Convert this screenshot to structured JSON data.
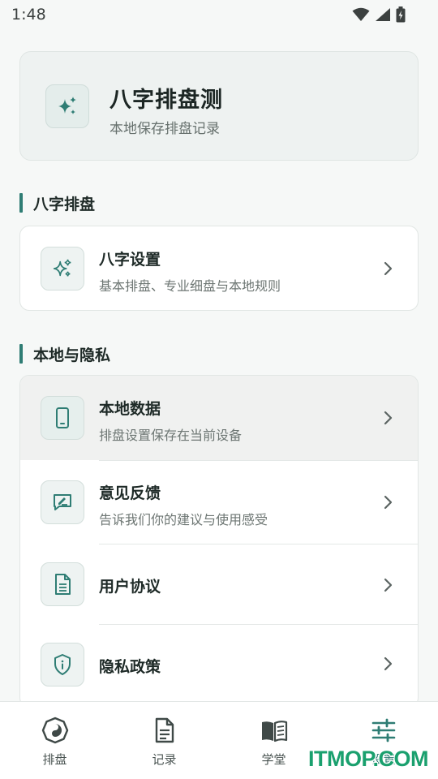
{
  "status_bar": {
    "time": "1:48"
  },
  "hero": {
    "title": "八字排盘测",
    "subtitle": "本地保存排盘记录",
    "icon": "sparkles-icon"
  },
  "sections": [
    {
      "title": "八字排盘",
      "items": [
        {
          "title": "八字设置",
          "subtitle": "基本排盘、专业细盘与本地规则",
          "icon": "sparkles-icon"
        }
      ]
    },
    {
      "title": "本地与隐私",
      "items": [
        {
          "title": "本地数据",
          "subtitle": "排盘设置保存在当前设备",
          "icon": "phone-icon"
        },
        {
          "title": "意见反馈",
          "subtitle": "告诉我们你的建议与使用感受",
          "icon": "feedback-icon"
        },
        {
          "title": "用户协议",
          "subtitle": "",
          "icon": "document-icon"
        },
        {
          "title": "隐私政策",
          "subtitle": "",
          "icon": "shield-info-icon"
        }
      ]
    }
  ],
  "bottom_nav": [
    {
      "label": "排盘",
      "icon": "bagua-icon",
      "active": false
    },
    {
      "label": "记录",
      "icon": "document-icon",
      "active": false
    },
    {
      "label": "学堂",
      "icon": "book-icon",
      "active": false
    },
    {
      "label": "设置",
      "icon": "sliders-icon",
      "active": true
    }
  ],
  "watermark": "ITMOP.COM",
  "colors": {
    "accent": "#2f7d74",
    "background": "#f6f8f7",
    "card": "#ffffff"
  }
}
